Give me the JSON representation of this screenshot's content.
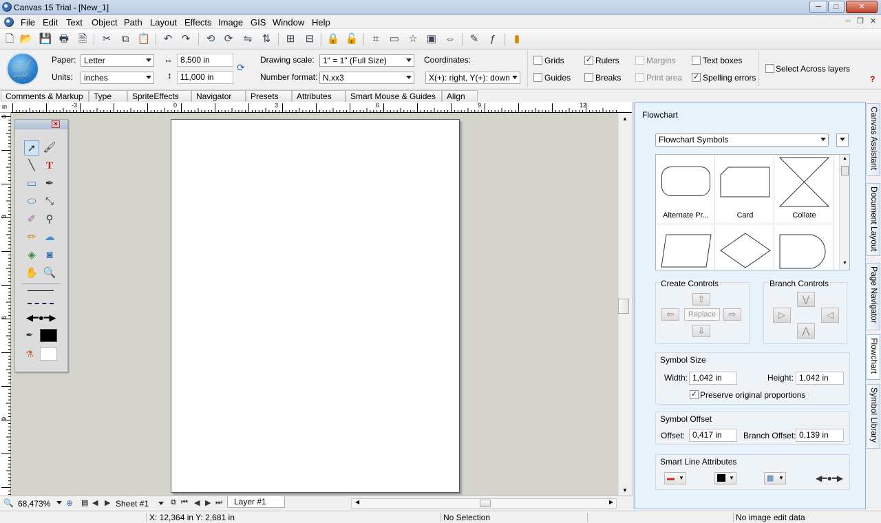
{
  "window": {
    "title": "Canvas 15 Trial - [New_1]",
    "min": "─",
    "max": "□",
    "close": "✕"
  },
  "menu": [
    "File",
    "Edit",
    "Text",
    "Object",
    "Path",
    "Layout",
    "Effects",
    "Image",
    "GIS",
    "Window",
    "Help"
  ],
  "props": {
    "paper_label": "Paper:",
    "paper_value": "Letter",
    "units_label": "Units:",
    "units_value": "inches",
    "width_value": "8,500 in",
    "height_value": "11,000 in",
    "drawing_scale_label": "Drawing scale:",
    "drawing_scale_value": "1\" = 1\" (Full Size)",
    "number_format_label": "Number format:",
    "number_format_value": "N.xx3",
    "coordinates_label": "Coordinates:",
    "coordinates_value": "X(+): right, Y(+): down",
    "checks": {
      "grids": {
        "label": "Grids",
        "checked": false
      },
      "rulers": {
        "label": "Rulers",
        "checked": true
      },
      "margins": {
        "label": "Margins",
        "checked": false
      },
      "text_boxes": {
        "label": "Text boxes",
        "checked": false
      },
      "guides": {
        "label": "Guides",
        "checked": false
      },
      "breaks": {
        "label": "Breaks",
        "checked": false
      },
      "print_area": {
        "label": "Print area",
        "checked": false
      },
      "spelling_errors": {
        "label": "Spelling errors",
        "checked": true
      },
      "select_across_layers": {
        "label": "Select Across layers",
        "checked": false
      }
    },
    "help": "?"
  },
  "tabs": [
    "Comments & Markup",
    "Type",
    "SpriteEffects",
    "Navigator",
    "Presets",
    "Attributes",
    "Smart Mouse & Guides",
    "Align"
  ],
  "ruler": {
    "unit": "in",
    "h_labels": [
      "-3",
      "0",
      "3",
      "6",
      "9",
      "12"
    ],
    "v_labels": [
      "0",
      "3",
      "6",
      "9"
    ]
  },
  "bottom": {
    "zoom": "68,473%",
    "sheet": "Sheet #1",
    "layer": "Layer #1"
  },
  "status": {
    "coords": "X: 12,364 in Y: 2,681 in",
    "selection": "No Selection",
    "image_edit": "No image edit data"
  },
  "panel": {
    "title": "Flowchart",
    "library_select": "Flowchart Symbols",
    "symbols": [
      "Alternate Pr...",
      "Card",
      "Collate"
    ],
    "create_controls": "Create Controls",
    "replace": "Replace",
    "branch_controls": "Branch Controls",
    "symbol_size": "Symbol Size",
    "width_label": "Width:",
    "width_value": "1,042 in",
    "height_label": "Height:",
    "height_value": "1,042 in",
    "preserve_label": "Preserve original proportions",
    "symbol_offset": "Symbol Offset",
    "offset_label": "Offset:",
    "offset_value": "0,417 in",
    "branch_offset_label": "Branch Offset:",
    "branch_offset_value": "0,139 in",
    "smart_line": "Smart Line Attributes"
  },
  "side_tabs": [
    "Canvas Assistant",
    "Document Layout",
    "Page Navigator",
    "Flowchart",
    "Symbol Library"
  ]
}
